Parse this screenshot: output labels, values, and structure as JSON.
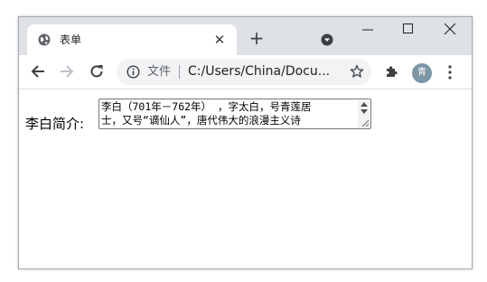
{
  "browser": {
    "tab": {
      "title": "表单",
      "close_glyph": "✕"
    },
    "new_tab_glyph": "+",
    "icons": {
      "favicon": "globe-icon",
      "tab_search": "tab-search-icon",
      "minimize": "minimize-icon",
      "maximize": "maximize-icon",
      "close": "close-icon",
      "back": "back-arrow-icon",
      "forward": "forward-arrow-icon",
      "reload": "reload-icon",
      "info": "info-icon",
      "bookmark": "star-icon",
      "extensions": "puzzle-icon",
      "menu": "kebab-menu-icon"
    },
    "address_bar": {
      "security_label": "文件",
      "url": "C:/Users/China/Docu..."
    },
    "profile_initial": "青"
  },
  "page": {
    "intro_label": "李白简介:",
    "intro_text": "李白（701年－762年），字太白，号青莲居士，又号“谪仙人”，唐代伟大的浪漫主义诗人",
    "intro_lines": [
      "李白（701年－762年） ，字太白，号青莲居",
      "士，又号“谪仙人”，唐代伟大的浪漫主义诗"
    ]
  },
  "colors": {
    "tabstrip": "#dee1e6",
    "omnibox": "#f1f3f4",
    "avatar": "#7c96a6"
  }
}
